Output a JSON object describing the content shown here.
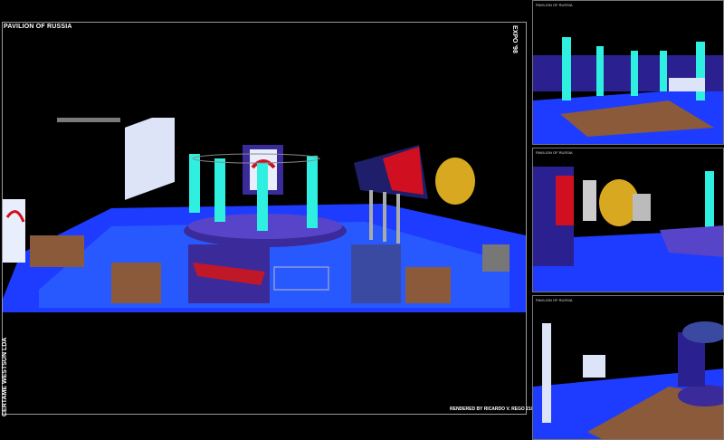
{
  "board": {
    "title": "PAVILION OF RUSSIA",
    "side_left": "CERTAME WESTSUN LDA",
    "side_right": "EXPO '98",
    "credit": "RENDERED BY RICARDO V. REGO 21/01/98"
  },
  "thumbnails": [
    {
      "caption": "PAVILION OF RUSSIA",
      "caption_bottom": ""
    },
    {
      "caption": "PAVILION OF RUSSIA",
      "caption_bottom": ""
    },
    {
      "caption": "PAVILION OF RUSSIA",
      "caption_bottom": ""
    }
  ],
  "colors": {
    "floor": "#1e3cff",
    "floor_light": "#2f6cff",
    "purple": "#3a2a9a",
    "cyan": "#2ff0e0",
    "wood": "#8a5a3a",
    "red": "#d01020"
  }
}
